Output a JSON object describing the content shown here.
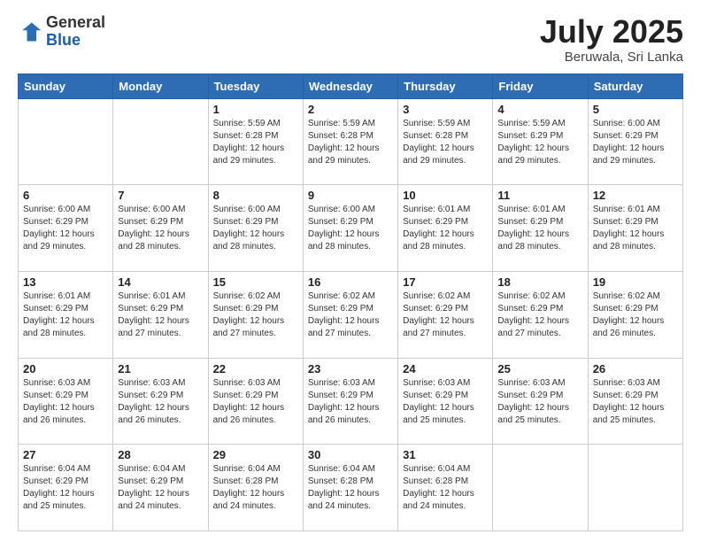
{
  "header": {
    "logo_general": "General",
    "logo_blue": "Blue",
    "month_title": "July 2025",
    "location": "Beruwala, Sri Lanka"
  },
  "days_of_week": [
    "Sunday",
    "Monday",
    "Tuesday",
    "Wednesday",
    "Thursday",
    "Friday",
    "Saturday"
  ],
  "weeks": [
    [
      {
        "day": "",
        "info": ""
      },
      {
        "day": "",
        "info": ""
      },
      {
        "day": "1",
        "info": "Sunrise: 5:59 AM\nSunset: 6:28 PM\nDaylight: 12 hours and 29 minutes."
      },
      {
        "day": "2",
        "info": "Sunrise: 5:59 AM\nSunset: 6:28 PM\nDaylight: 12 hours and 29 minutes."
      },
      {
        "day": "3",
        "info": "Sunrise: 5:59 AM\nSunset: 6:28 PM\nDaylight: 12 hours and 29 minutes."
      },
      {
        "day": "4",
        "info": "Sunrise: 5:59 AM\nSunset: 6:29 PM\nDaylight: 12 hours and 29 minutes."
      },
      {
        "day": "5",
        "info": "Sunrise: 6:00 AM\nSunset: 6:29 PM\nDaylight: 12 hours and 29 minutes."
      }
    ],
    [
      {
        "day": "6",
        "info": "Sunrise: 6:00 AM\nSunset: 6:29 PM\nDaylight: 12 hours and 29 minutes."
      },
      {
        "day": "7",
        "info": "Sunrise: 6:00 AM\nSunset: 6:29 PM\nDaylight: 12 hours and 28 minutes."
      },
      {
        "day": "8",
        "info": "Sunrise: 6:00 AM\nSunset: 6:29 PM\nDaylight: 12 hours and 28 minutes."
      },
      {
        "day": "9",
        "info": "Sunrise: 6:00 AM\nSunset: 6:29 PM\nDaylight: 12 hours and 28 minutes."
      },
      {
        "day": "10",
        "info": "Sunrise: 6:01 AM\nSunset: 6:29 PM\nDaylight: 12 hours and 28 minutes."
      },
      {
        "day": "11",
        "info": "Sunrise: 6:01 AM\nSunset: 6:29 PM\nDaylight: 12 hours and 28 minutes."
      },
      {
        "day": "12",
        "info": "Sunrise: 6:01 AM\nSunset: 6:29 PM\nDaylight: 12 hours and 28 minutes."
      }
    ],
    [
      {
        "day": "13",
        "info": "Sunrise: 6:01 AM\nSunset: 6:29 PM\nDaylight: 12 hours and 28 minutes."
      },
      {
        "day": "14",
        "info": "Sunrise: 6:01 AM\nSunset: 6:29 PM\nDaylight: 12 hours and 27 minutes."
      },
      {
        "day": "15",
        "info": "Sunrise: 6:02 AM\nSunset: 6:29 PM\nDaylight: 12 hours and 27 minutes."
      },
      {
        "day": "16",
        "info": "Sunrise: 6:02 AM\nSunset: 6:29 PM\nDaylight: 12 hours and 27 minutes."
      },
      {
        "day": "17",
        "info": "Sunrise: 6:02 AM\nSunset: 6:29 PM\nDaylight: 12 hours and 27 minutes."
      },
      {
        "day": "18",
        "info": "Sunrise: 6:02 AM\nSunset: 6:29 PM\nDaylight: 12 hours and 27 minutes."
      },
      {
        "day": "19",
        "info": "Sunrise: 6:02 AM\nSunset: 6:29 PM\nDaylight: 12 hours and 26 minutes."
      }
    ],
    [
      {
        "day": "20",
        "info": "Sunrise: 6:03 AM\nSunset: 6:29 PM\nDaylight: 12 hours and 26 minutes."
      },
      {
        "day": "21",
        "info": "Sunrise: 6:03 AM\nSunset: 6:29 PM\nDaylight: 12 hours and 26 minutes."
      },
      {
        "day": "22",
        "info": "Sunrise: 6:03 AM\nSunset: 6:29 PM\nDaylight: 12 hours and 26 minutes."
      },
      {
        "day": "23",
        "info": "Sunrise: 6:03 AM\nSunset: 6:29 PM\nDaylight: 12 hours and 26 minutes."
      },
      {
        "day": "24",
        "info": "Sunrise: 6:03 AM\nSunset: 6:29 PM\nDaylight: 12 hours and 25 minutes."
      },
      {
        "day": "25",
        "info": "Sunrise: 6:03 AM\nSunset: 6:29 PM\nDaylight: 12 hours and 25 minutes."
      },
      {
        "day": "26",
        "info": "Sunrise: 6:03 AM\nSunset: 6:29 PM\nDaylight: 12 hours and 25 minutes."
      }
    ],
    [
      {
        "day": "27",
        "info": "Sunrise: 6:04 AM\nSunset: 6:29 PM\nDaylight: 12 hours and 25 minutes."
      },
      {
        "day": "28",
        "info": "Sunrise: 6:04 AM\nSunset: 6:29 PM\nDaylight: 12 hours and 24 minutes."
      },
      {
        "day": "29",
        "info": "Sunrise: 6:04 AM\nSunset: 6:28 PM\nDaylight: 12 hours and 24 minutes."
      },
      {
        "day": "30",
        "info": "Sunrise: 6:04 AM\nSunset: 6:28 PM\nDaylight: 12 hours and 24 minutes."
      },
      {
        "day": "31",
        "info": "Sunrise: 6:04 AM\nSunset: 6:28 PM\nDaylight: 12 hours and 24 minutes."
      },
      {
        "day": "",
        "info": ""
      },
      {
        "day": "",
        "info": ""
      }
    ]
  ]
}
